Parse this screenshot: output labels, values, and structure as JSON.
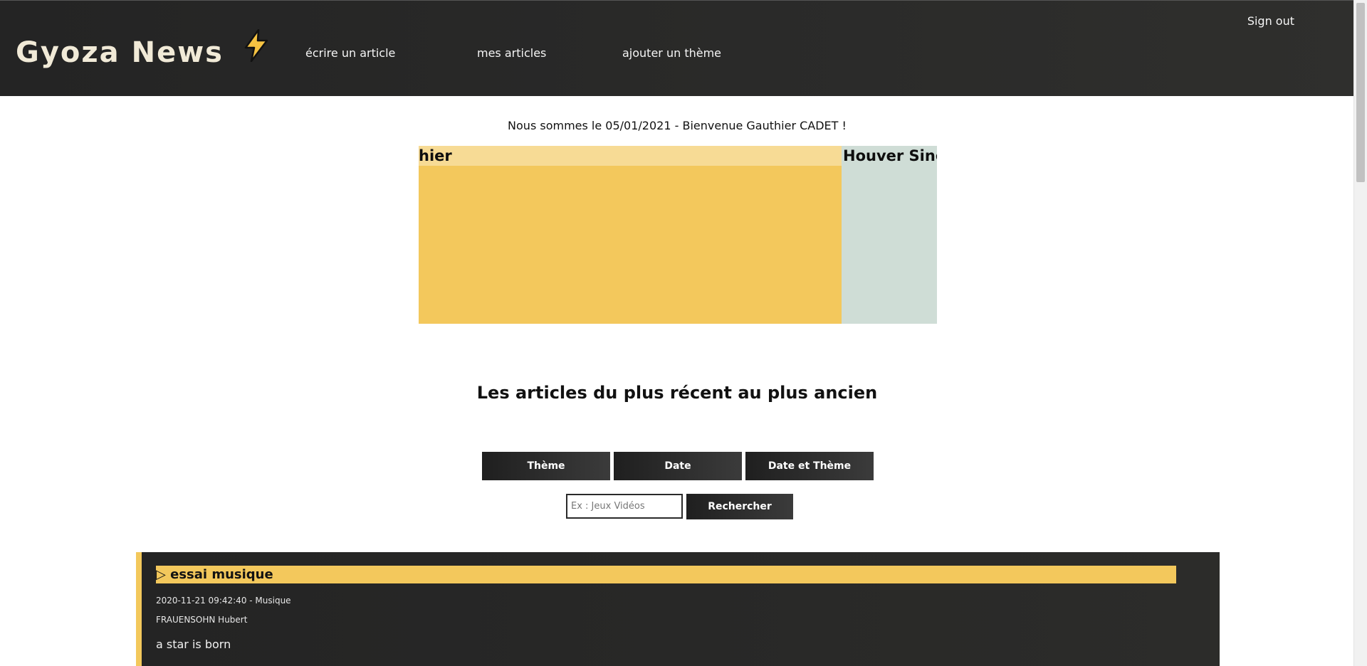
{
  "header": {
    "logo": "Gyoza News",
    "logo_icon": "⚡",
    "nav": [
      "écrire un article",
      "mes articles",
      "ajouter un thème"
    ],
    "signout": "Sign out"
  },
  "welcome": "Nous sommes le 05/01/2021 - Bienvenue Gauthier CADET !",
  "carousel": [
    {
      "title": "hier",
      "color": "#f3c85c"
    },
    {
      "title": "Houver Sing",
      "color": "#cfddd6"
    }
  ],
  "section_title": "Les articles du plus récent au plus ancien",
  "filters": [
    "Thème",
    "Date",
    "Date et Thème"
  ],
  "search": {
    "placeholder": "Ex : Jeux Vidéos",
    "button": "Rechercher"
  },
  "article": {
    "title": "▷ essai musique",
    "meta": "2020-11-21 09:42:40 - Musique",
    "author": "FRAUENSOHN Hubert",
    "body": "a star is born"
  },
  "colors": {
    "accent": "#f3c85c",
    "header_bg": "#242424"
  }
}
